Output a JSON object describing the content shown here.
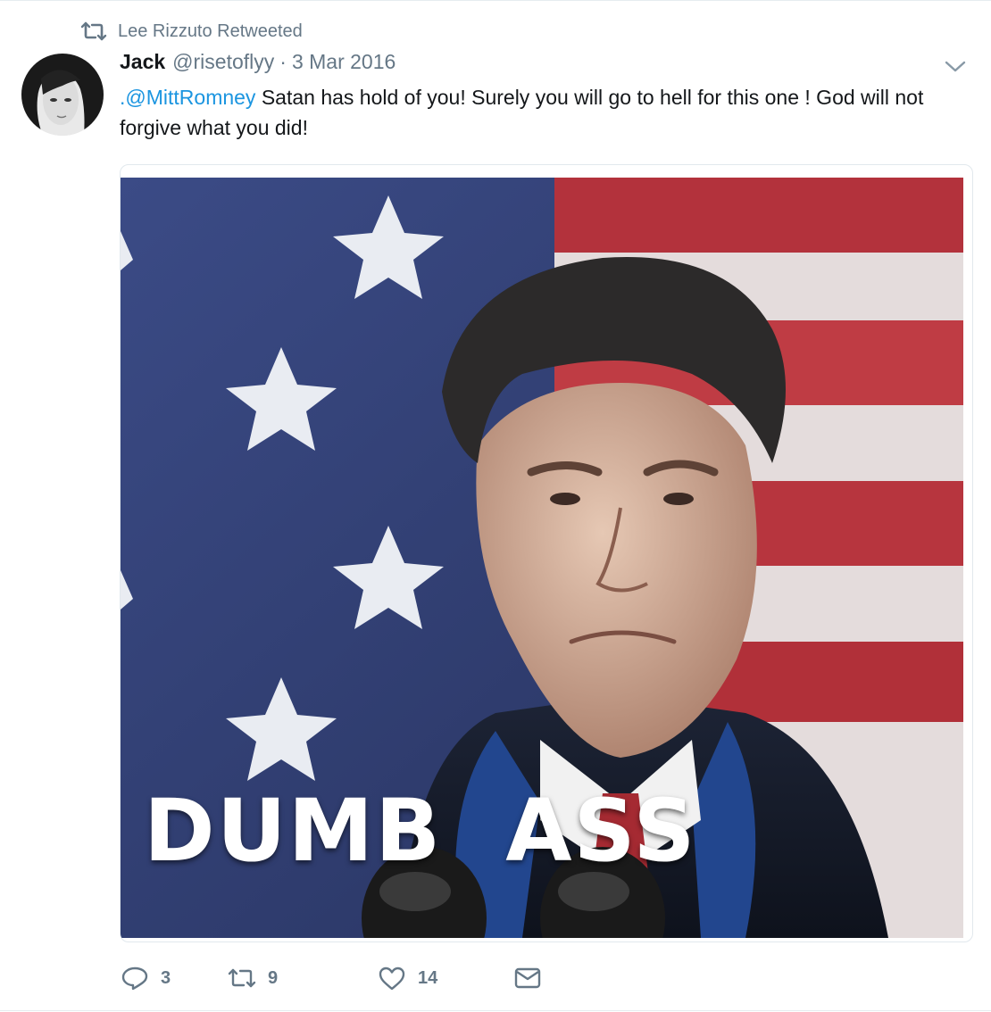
{
  "retweet_context": {
    "icon": "retweet-icon",
    "text": "Lee Rizzuto Retweeted"
  },
  "author": {
    "name": "Jack",
    "handle": "@risetoflyy",
    "separator": "·",
    "date": "3 Mar 2016"
  },
  "tweet": {
    "mention": ".@MittRomney",
    "text": " Satan has hold of you! Surely you will go to hell for this one ! God will not forgive what you did!"
  },
  "media": {
    "caption": "DUMB  ASS"
  },
  "actions": {
    "reply": {
      "icon": "reply-icon",
      "count": "3"
    },
    "retweet": {
      "icon": "retweet-icon",
      "count": "9"
    },
    "like": {
      "icon": "heart-icon",
      "count": "14"
    },
    "dm": {
      "icon": "envelope-icon"
    }
  },
  "colors": {
    "link": "#1b95e0",
    "secondary_text": "#657786",
    "flag_blue": "#3a4a7a",
    "flag_red": "#b8323a"
  }
}
